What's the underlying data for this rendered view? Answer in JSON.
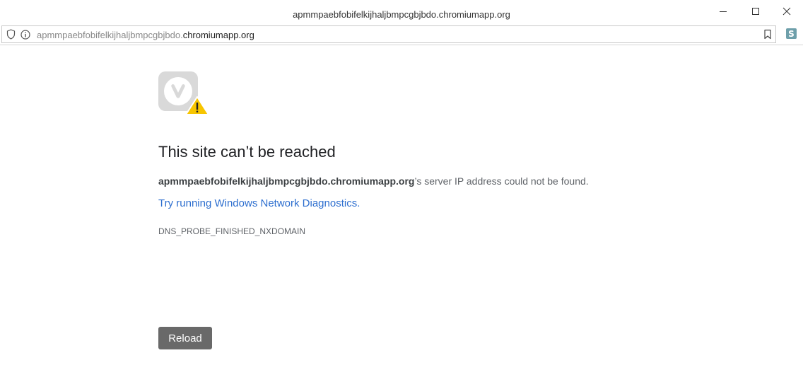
{
  "window": {
    "title": "apmmpaebfobifelkijhaljbmpcgbjbdo.chromiumapp.org"
  },
  "address_bar": {
    "url_prefix": "apmmpaebfobifelkijhaljbmpcgbjbdo.",
    "url_domain": "chromiumapp.org",
    "extension_letter": "S"
  },
  "error_page": {
    "heading": "This site can’t be reached",
    "host": "apmmpaebfobifelkijhaljbmpcgbjbdo.chromiumapp.org",
    "message_suffix": "’s server IP address could not be found.",
    "diagnostics_link": "Try running Windows Network Diagnostics",
    "diagnostics_period": ".",
    "error_code": "DNS_PROBE_FINISHED_NXDOMAIN",
    "reload_label": "Reload"
  },
  "colors": {
    "link": "#2e6fcf",
    "reload_button": "#696969",
    "warning": "#f7c500",
    "extension": "#6e9faa"
  }
}
